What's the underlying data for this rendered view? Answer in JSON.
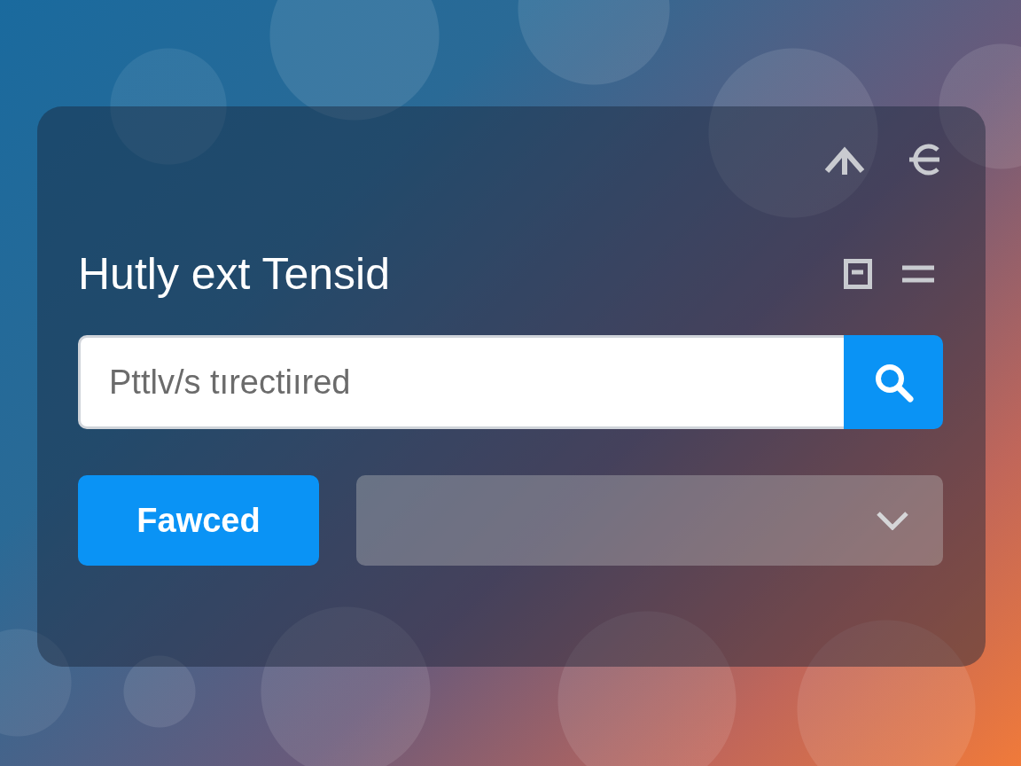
{
  "title": "Hutly ext Tensid",
  "search": {
    "placeholder": "Pttlv/s tırectiıred"
  },
  "primary_button": {
    "label": "Fawced"
  }
}
